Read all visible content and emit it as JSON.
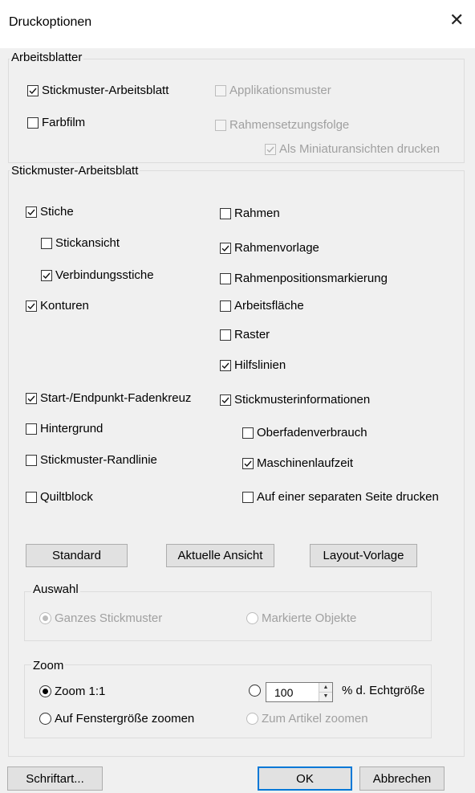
{
  "dialog": {
    "title": "Druckoptionen",
    "close_glyph": "✕"
  },
  "worksheets": {
    "legend": "Arbeitsblatter",
    "stickmuster_arbeitsblatt": {
      "label": "Stickmuster-Arbeitsblatt",
      "checked": true
    },
    "farbfilm": {
      "label": "Farbfilm",
      "checked": false
    },
    "applikationsmuster": {
      "label": "Applikationsmuster",
      "checked": false,
      "disabled": true
    },
    "rahmensetzungsfolge": {
      "label": "Rahmensetzungsfolge",
      "checked": false,
      "disabled": true
    },
    "miniaturansichten": {
      "label": "Als Miniaturansichten drucken",
      "checked": true,
      "disabled": true
    }
  },
  "sheet": {
    "legend": "Stickmuster-Arbeitsblatt",
    "left": {
      "stiche": {
        "label": "Stiche",
        "checked": true
      },
      "stickansicht": {
        "label": "Stickansicht",
        "checked": false
      },
      "verbindungsstiche": {
        "label": "Verbindungsstiche",
        "checked": true
      },
      "konturen": {
        "label": "Konturen",
        "checked": true
      },
      "fadenkreuz": {
        "label": "Start-/Endpunkt-Fadenkreuz",
        "checked": true
      },
      "hintergrund": {
        "label": "Hintergrund",
        "checked": false
      },
      "randlinie": {
        "label": "Stickmuster-Randlinie",
        "checked": false
      },
      "quiltblock": {
        "label": "Quiltblock",
        "checked": false
      }
    },
    "right": {
      "rahmen": {
        "label": "Rahmen",
        "checked": false
      },
      "rahmenvorlage": {
        "label": "Rahmenvorlage",
        "checked": true
      },
      "rahmenpositionsmarkierung": {
        "label": "Rahmenpositionsmarkierung",
        "checked": false
      },
      "arbeitsflaeche": {
        "label": "Arbeitsfläche",
        "checked": false
      },
      "raster": {
        "label": "Raster",
        "checked": false
      },
      "hilfslinien": {
        "label": "Hilfslinien",
        "checked": true
      },
      "stickmusterinformationen": {
        "label": "Stickmusterinformationen",
        "checked": true
      },
      "oberfadenverbrauch": {
        "label": "Oberfadenverbrauch",
        "checked": false
      },
      "maschinenlaufzeit": {
        "label": "Maschinenlaufzeit",
        "checked": true
      },
      "separate_seite": {
        "label": "Auf einer separaten Seite drucken",
        "checked": false
      }
    },
    "buttons": {
      "standard": "Standard",
      "aktuelle_ansicht": "Aktuelle Ansicht",
      "layout_vorlage": "Layout-Vorlage"
    }
  },
  "auswahl": {
    "legend": "Auswahl",
    "ganzes": {
      "label": "Ganzes Stickmuster",
      "selected": true,
      "disabled": true
    },
    "markierte": {
      "label": "Markierte Objekte",
      "selected": false,
      "disabled": true
    }
  },
  "zoom": {
    "legend": "Zoom",
    "zoom_1_1": {
      "label": "Zoom 1:1",
      "selected": true
    },
    "fenstergroesse": {
      "label": "Auf Fenstergröße zoomen",
      "selected": false
    },
    "percent": {
      "selected": false,
      "value": "100",
      "suffix": "% d. Echtgröße"
    },
    "artikel": {
      "label": "Zum Artikel zoomen",
      "selected": false,
      "disabled": true
    }
  },
  "footer": {
    "schriftart": "Schriftart...",
    "ok": "OK",
    "abbrechen": "Abbrechen"
  }
}
